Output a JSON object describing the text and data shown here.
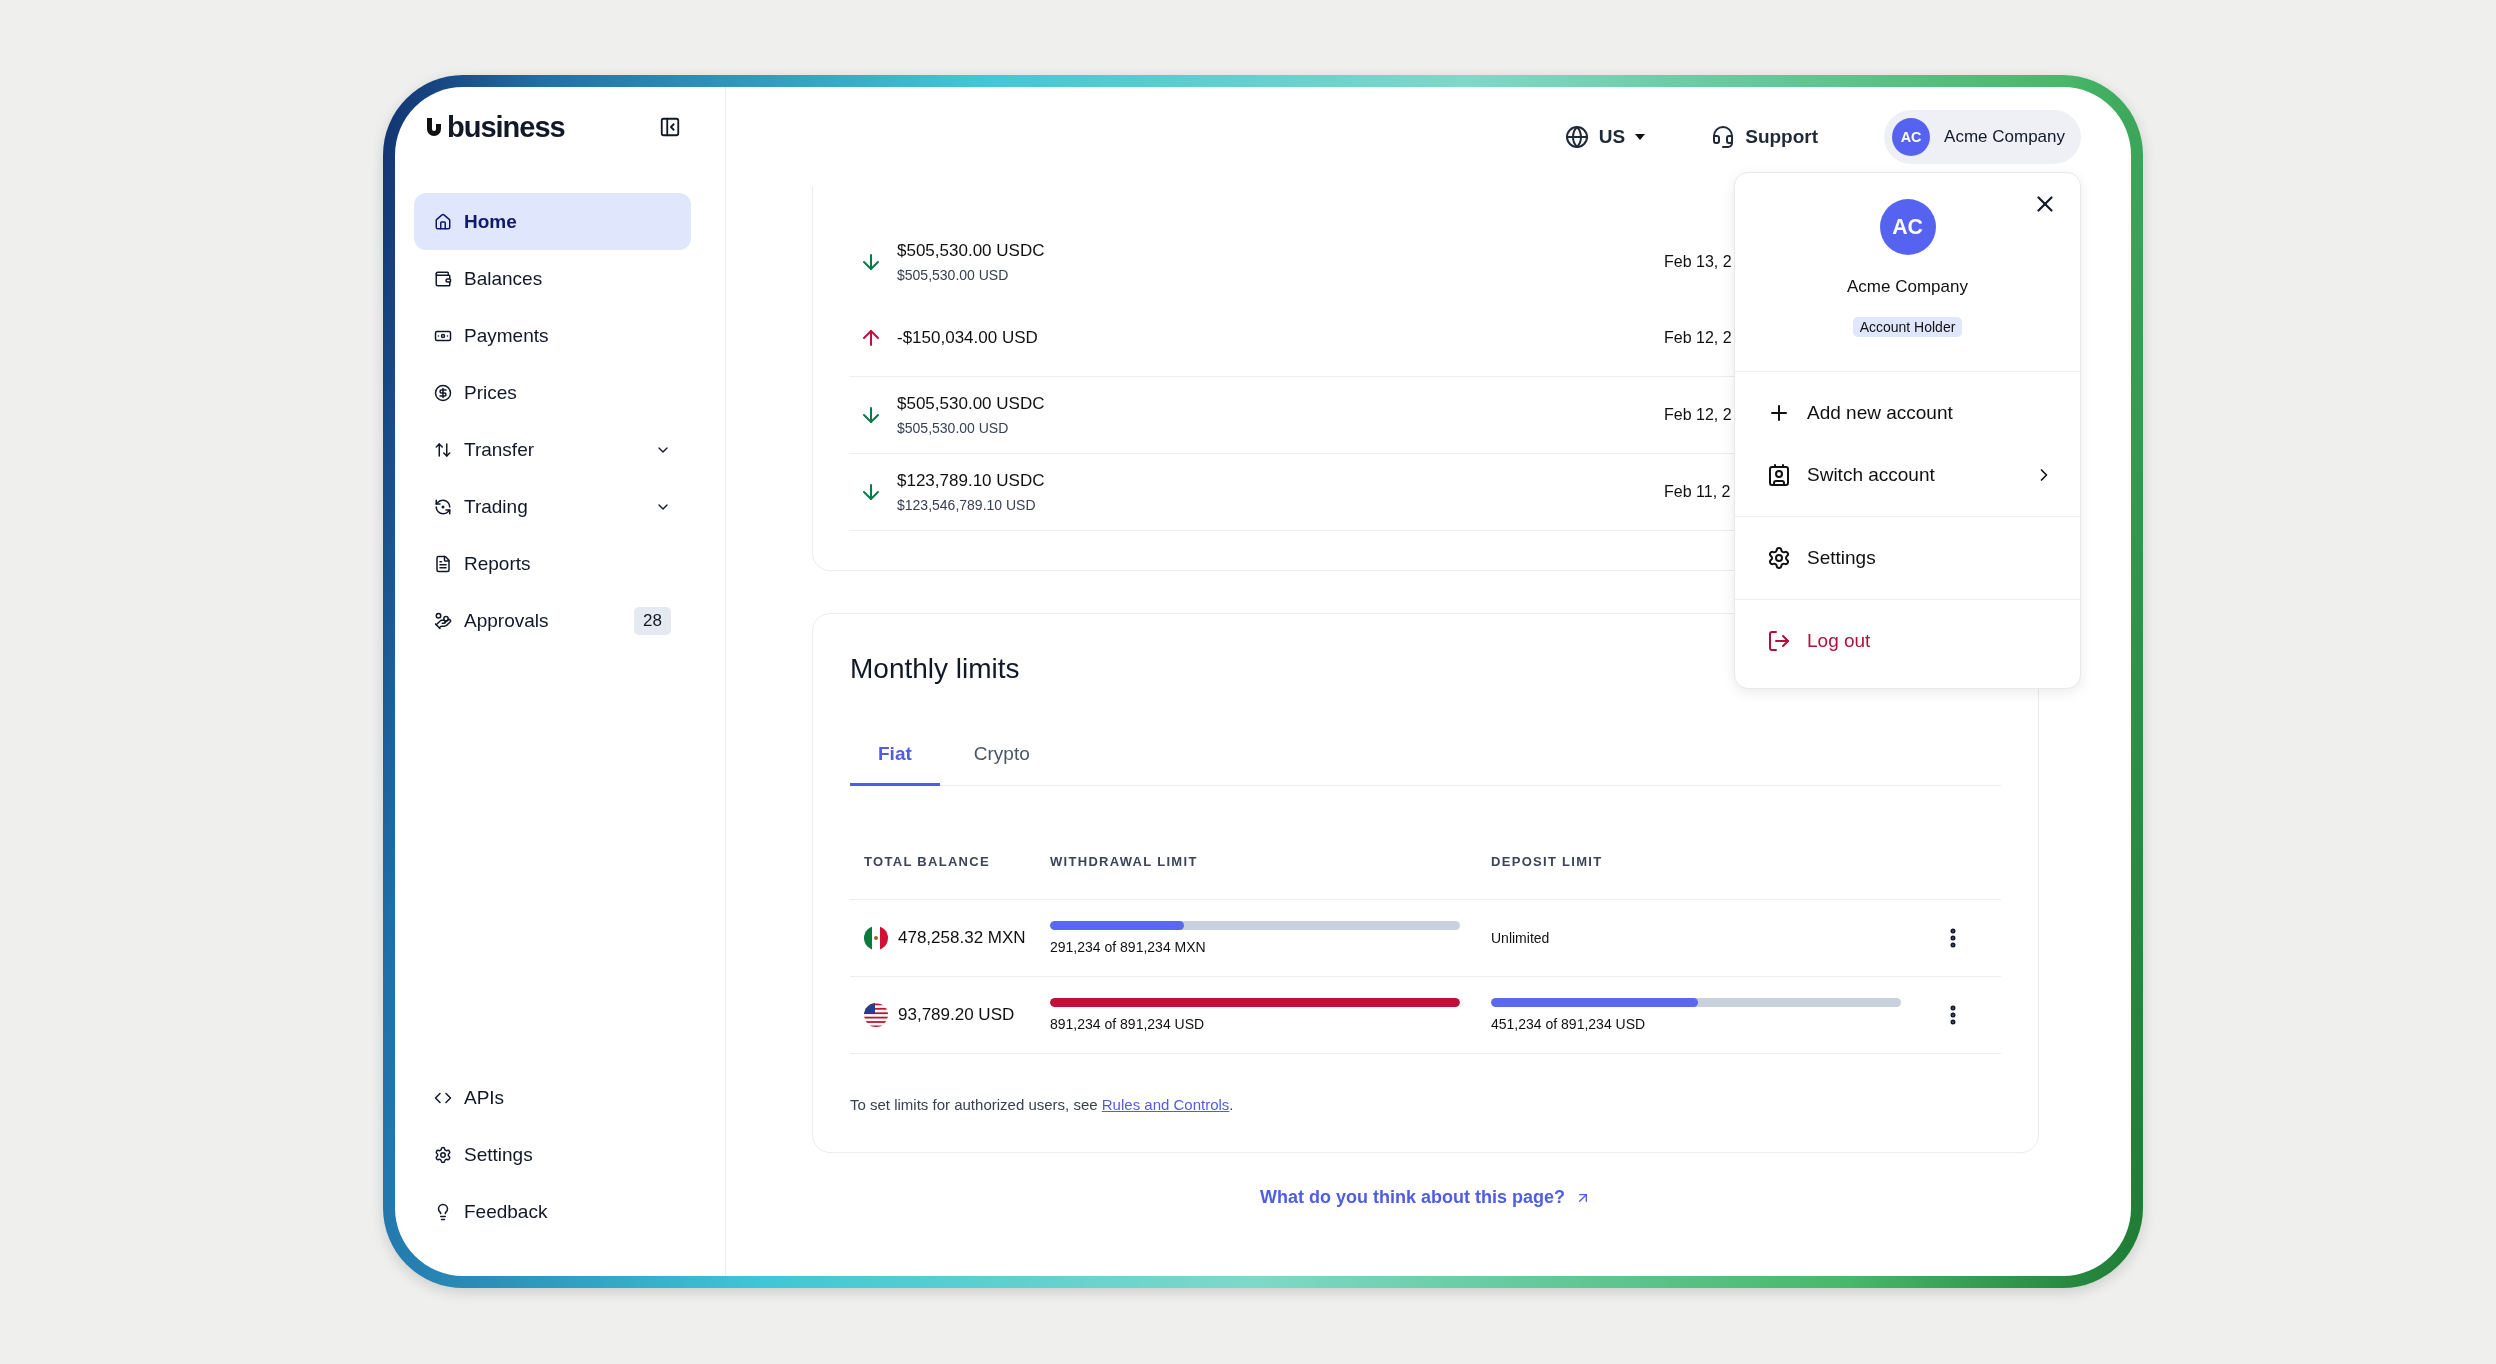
{
  "sidebar": {
    "logo": "business",
    "items": [
      {
        "label": "Home",
        "kind": "home",
        "selected": true,
        "expandable": false
      },
      {
        "label": "Balances",
        "kind": "wallet",
        "selected": false,
        "expandable": false
      },
      {
        "label": "Payments",
        "kind": "cash",
        "selected": false,
        "expandable": false
      },
      {
        "label": "Prices",
        "kind": "dollar",
        "selected": false,
        "expandable": false
      },
      {
        "label": "Transfer",
        "kind": "transfer",
        "selected": false,
        "expandable": true
      },
      {
        "label": "Trading",
        "kind": "trading",
        "selected": false,
        "expandable": true
      },
      {
        "label": "Reports",
        "kind": "report",
        "selected": false,
        "expandable": false
      },
      {
        "label": "Approvals",
        "kind": "approval",
        "selected": false,
        "expandable": false,
        "badge": "28"
      }
    ],
    "bottom_items": [
      {
        "label": "APIs",
        "kind": "code"
      },
      {
        "label": "Settings",
        "kind": "gear"
      },
      {
        "label": "Feedback",
        "kind": "bulb"
      }
    ]
  },
  "header": {
    "region": "US",
    "support": "Support",
    "account": {
      "initials": "AC",
      "name": "Acme Company"
    }
  },
  "transactions": [
    {
      "kind": "in",
      "amount": "$505,530.00 USDC",
      "secondary": "$505,530.00 USD",
      "date": "Feb 13, 2"
    },
    {
      "kind": "out",
      "amount": "-$150,034.00 USD",
      "date": "Feb 12, 2"
    },
    {
      "kind": "in",
      "amount": "$505,530.00 USDC",
      "secondary": "$505,530.00 USD",
      "date": "Feb 12, 2"
    },
    {
      "kind": "in",
      "amount": "$123,789.10 USDC",
      "secondary": "$123,546,789.10 USD",
      "date": "Feb 11, 2"
    }
  ],
  "monthly_limits": {
    "title": "Monthly limits",
    "tabs": [
      {
        "label": "Fiat",
        "selected": true
      },
      {
        "label": "Crypto",
        "selected": false
      }
    ],
    "columns": [
      "TOTAL BALANCE",
      "WITHDRAWAL LIMIT",
      "DEPOSIT LIMIT"
    ],
    "rows": [
      {
        "kind": "mx",
        "balance": "478,258.32 MXN",
        "withdrawal": {
          "level": 0.327,
          "color": "#5a67f2",
          "text": "291,234 of 891,234 MXN"
        },
        "deposit": {
          "text": "Unlimited"
        }
      },
      {
        "kind": "us",
        "balance": "93,789.20 USD",
        "withdrawal": {
          "level": 1,
          "color": "#c0103a",
          "text": "891,234 of 891,234 USD"
        },
        "deposit": {
          "level": 0.506,
          "color": "#5a67f2",
          "text": "451,234 of 891,234 USD"
        }
      }
    ],
    "note": {
      "before": "To set limits for authorized users, see ",
      "link": "Rules and Controls",
      "after": "."
    }
  },
  "feedback_link": "What do you think about this page?",
  "account_menu": {
    "initials": "AC",
    "name": "Acme Company",
    "role": "Account Holder",
    "sections": [
      [
        {
          "kind": "add",
          "label": "Add new account",
          "submenu": false,
          "danger": false
        },
        {
          "kind": "switch",
          "label": "Switch account",
          "submenu": true,
          "danger": false
        }
      ],
      [
        {
          "kind": "settings",
          "label": "Settings",
          "submenu": false,
          "danger": false
        }
      ],
      [
        {
          "kind": "logout",
          "label": "Log out",
          "submenu": false,
          "danger": true
        }
      ]
    ]
  }
}
